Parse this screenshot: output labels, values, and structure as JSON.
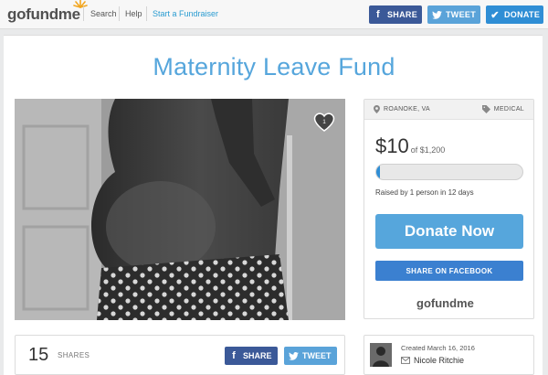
{
  "nav": {
    "logo_go": "go",
    "logo_fund": "fund",
    "logo_me": "me",
    "links": [
      "Search",
      "Help",
      "Start a Fundraiser"
    ],
    "share_label": "SHARE",
    "tweet_label": "TWEET",
    "donate_label": "DONATE"
  },
  "campaign": {
    "title": "Maternity Leave Fund",
    "likes": "1",
    "location": "ROANOKE, VA",
    "category": "MEDICAL",
    "raised": "$10",
    "goal_text": "of $1,200",
    "progress_fraction": 0.0083,
    "raised_by": "Raised by 1 person in 12 days",
    "donate_now": "Donate Now",
    "share_facebook": "SHARE ON FACEBOOK"
  },
  "shares": {
    "count": "15",
    "label": "SHARES",
    "share_label": "SHARE",
    "tweet_label": "TWEET"
  },
  "creator": {
    "created": "Created March 16, 2016",
    "name": "Nicole Ritchie"
  },
  "colors": {
    "brand_blue": "#56a6dc",
    "facebook": "#3b5998",
    "twitter": "#5aa3d9",
    "donate": "#2f8ed5"
  }
}
